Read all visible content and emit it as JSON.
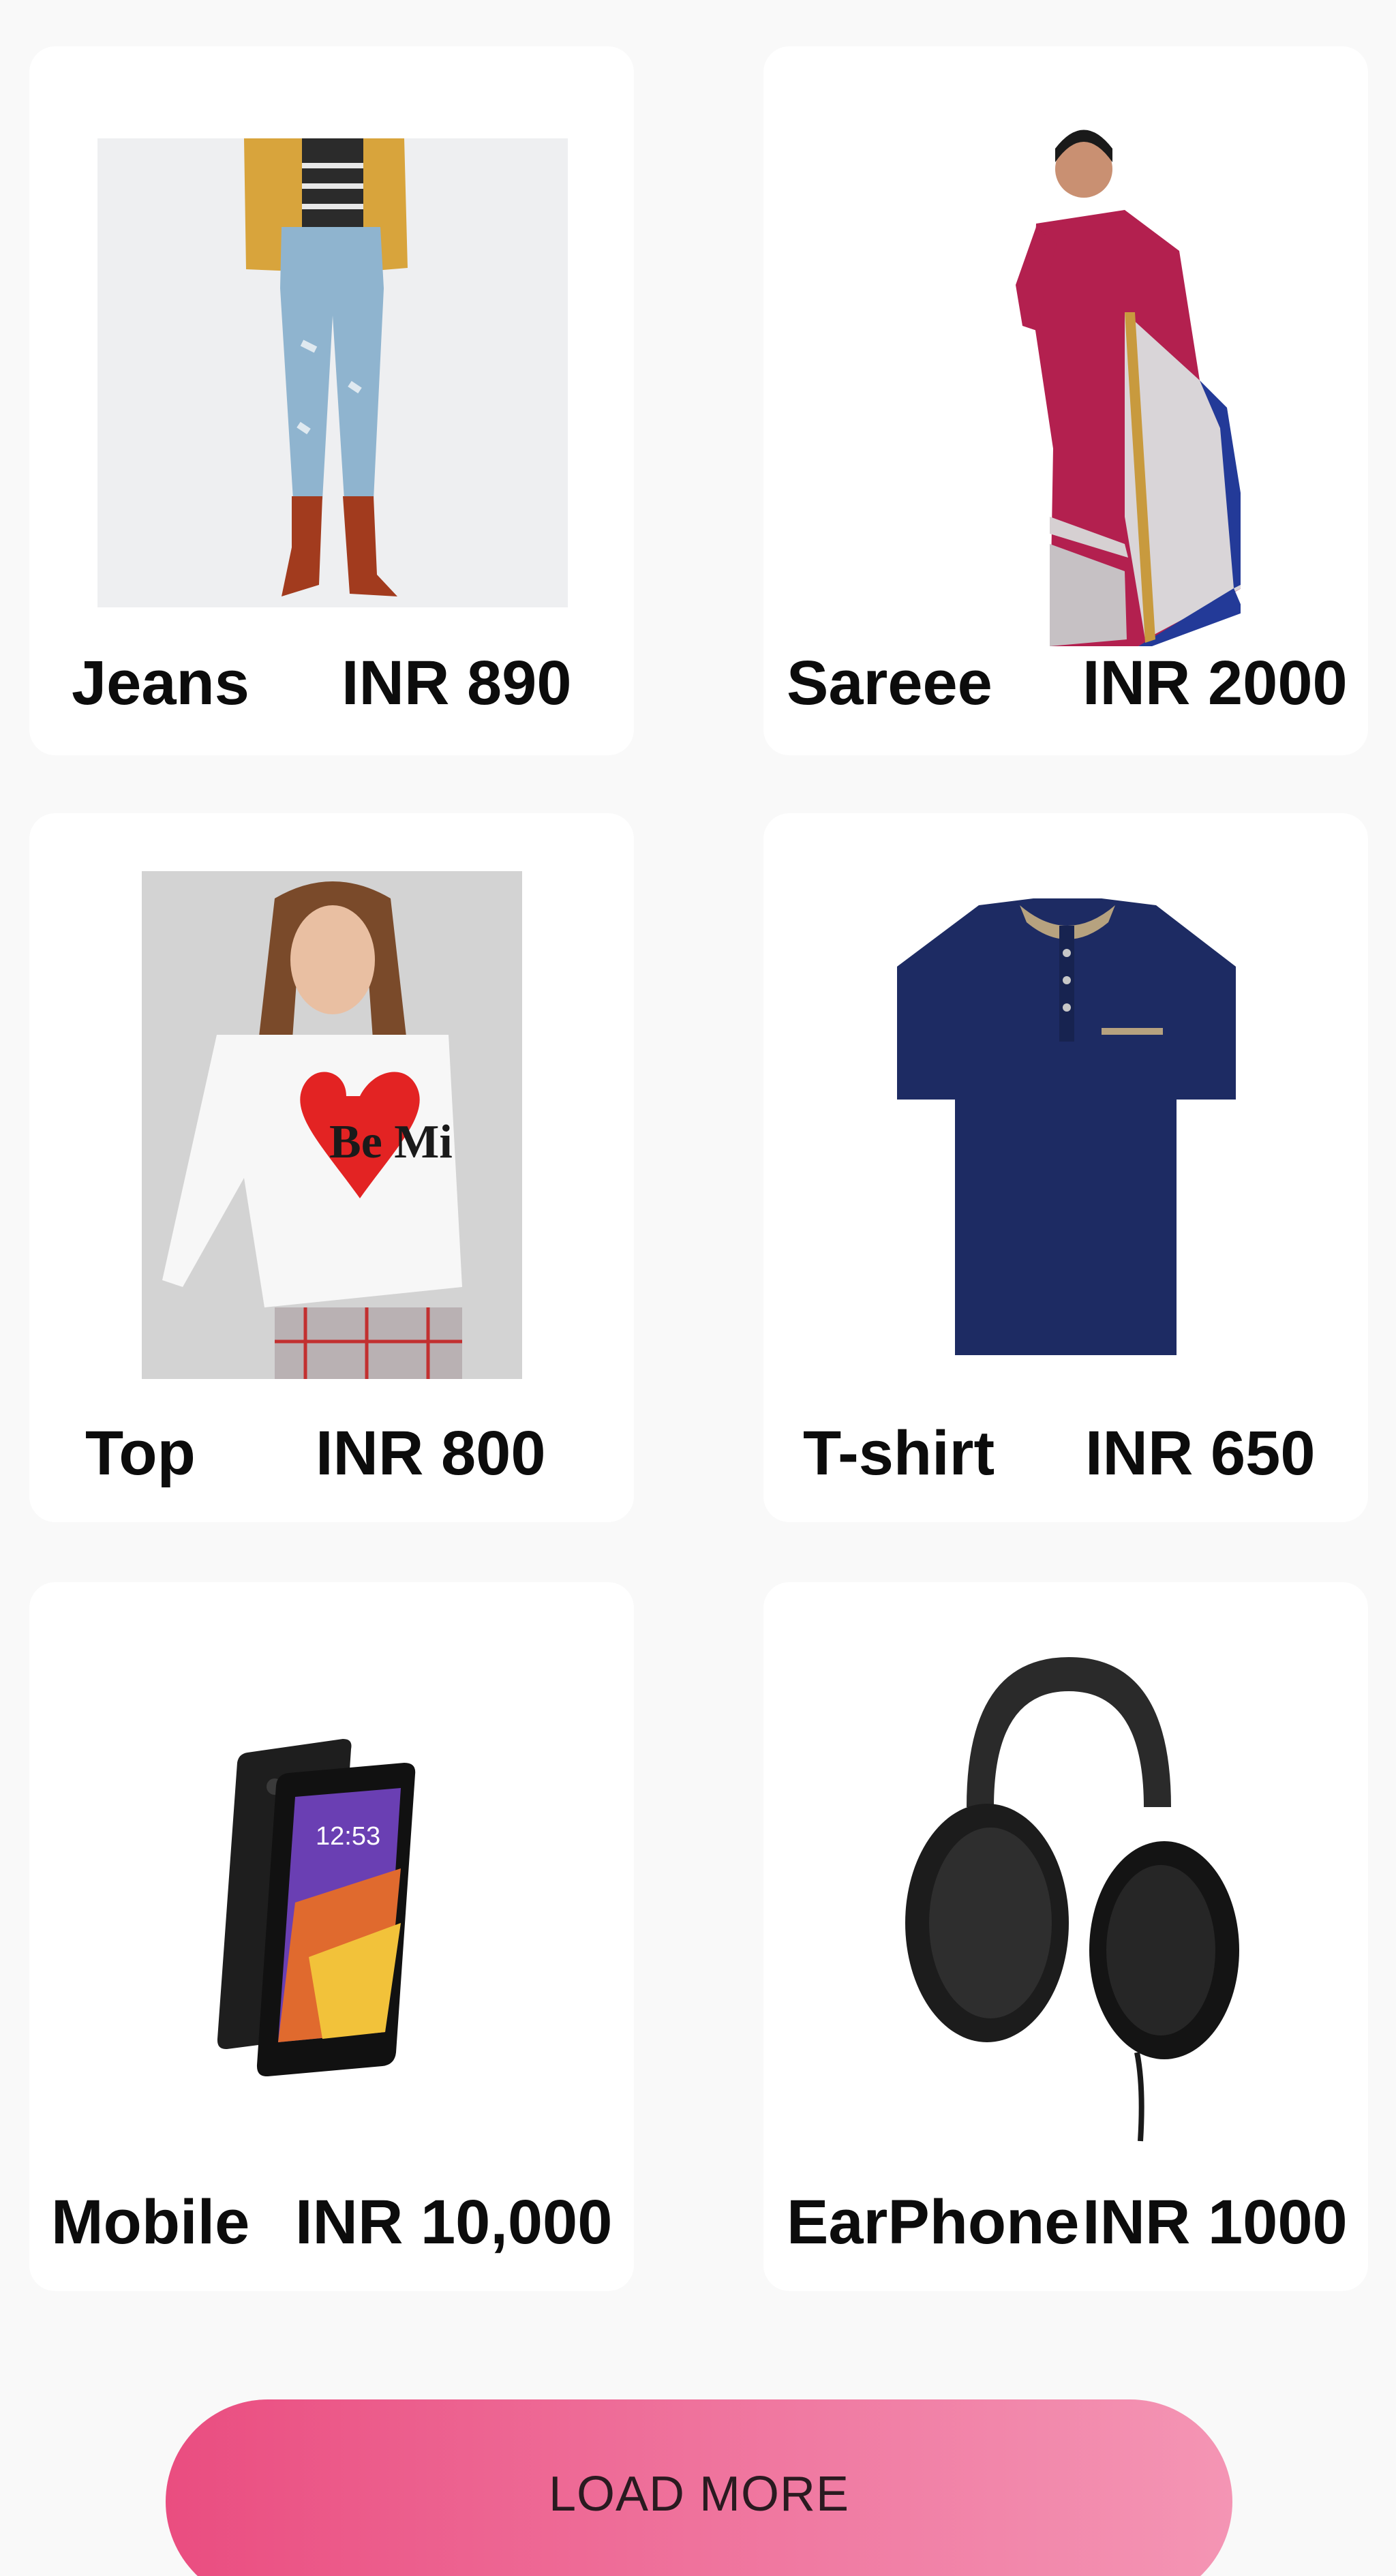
{
  "products": [
    {
      "name": "Jeans",
      "price": "INR 890",
      "image": "jeans-photo"
    },
    {
      "name": "Sareee",
      "price": "INR 2000",
      "image": "saree-photo"
    },
    {
      "name": "Top",
      "price": "INR 800",
      "image": "top-photo"
    },
    {
      "name": "T-shirt",
      "price": "INR 650",
      "image": "tshirt-photo"
    },
    {
      "name": "Mobile",
      "price": "INR 10,000",
      "image": "mobile-photo"
    },
    {
      "name": "EarPhone",
      "price": "INR 1000",
      "image": "headphones-photo"
    }
  ],
  "load_more": {
    "label": "LOAD MORE"
  },
  "colors": {
    "background": "#f9f9f9",
    "card": "#ffffff",
    "button_gradient_start": "#ea4d80",
    "button_gradient_end": "#f495b4",
    "text": "#0c0c0c"
  }
}
